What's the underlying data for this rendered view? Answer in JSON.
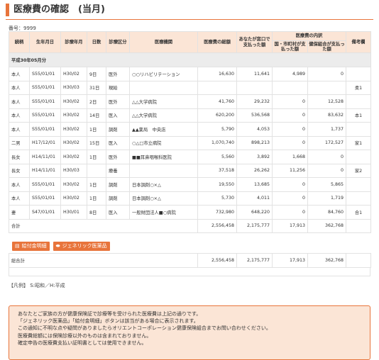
{
  "title": "医療費の確認　(当月)",
  "number_line": "番号：9999",
  "columns": {
    "name": "続柄",
    "birth": "生年月日",
    "service_month": "診療年月",
    "days": "日数",
    "category": "診療区分",
    "institution": "医療機関",
    "total": "医療費の総額",
    "patient_paid": "あなたが窓口で支払った額",
    "breakdown": "医療費の内訳",
    "public_paid": "国・市町村が支払った額",
    "insurer_paid": "健保組合が支払った額",
    "notes": "備考欄"
  },
  "group_label": "平成30年05月分",
  "rows": [
    {
      "rel": "本人",
      "birth": "S55/01/01",
      "month": "H30/02",
      "days": "9日",
      "cat": "医外",
      "inst": "○○リハビリテーション",
      "total": "16,630",
      "paid": "11,641",
      "public": "4,989",
      "insurer": "0",
      "note": ""
    },
    {
      "rel": "本人",
      "birth": "S55/01/01",
      "month": "H30/03",
      "days": "31日",
      "cat": "現給",
      "inst": "",
      "total": "",
      "paid": "",
      "public": "",
      "insurer": "",
      "note": "柔1"
    },
    {
      "rel": "本人",
      "birth": "S55/01/01",
      "month": "H30/02",
      "days": "2日",
      "cat": "医外",
      "inst": "△△大学病院",
      "total": "41,760",
      "paid": "29,232",
      "public": "0",
      "insurer": "12,528",
      "note": ""
    },
    {
      "rel": "本人",
      "birth": "S55/01/01",
      "month": "H30/02",
      "days": "14日",
      "cat": "医入",
      "inst": "△△大学病院",
      "total": "620,200",
      "paid": "536,568",
      "public": "0",
      "insurer": "83,632",
      "note": "本1"
    },
    {
      "rel": "本人",
      "birth": "S55/01/01",
      "month": "H30/02",
      "days": "1日",
      "cat": "調剤",
      "inst": "▲▲薬局　中央店",
      "total": "5,790",
      "paid": "4,053",
      "public": "0",
      "insurer": "1,737",
      "note": ""
    },
    {
      "rel": "二男",
      "birth": "H17/12/01",
      "month": "H30/02",
      "days": "15日",
      "cat": "医入",
      "inst": "○△□市立病院",
      "total": "1,070,740",
      "paid": "898,213",
      "public": "0",
      "insurer": "172,527",
      "note": "家1"
    },
    {
      "rel": "長女",
      "birth": "H14/11/01",
      "month": "H30/02",
      "days": "1日",
      "cat": "医外",
      "inst": "■■耳鼻咽喉科医院",
      "total": "5,560",
      "paid": "3,892",
      "public": "1,668",
      "insurer": "0",
      "note": ""
    },
    {
      "rel": "長女",
      "birth": "H14/11/01",
      "month": "H30/03",
      "days": "",
      "cat": "療養",
      "inst": "",
      "total": "37,518",
      "paid": "26,262",
      "public": "11,256",
      "insurer": "0",
      "note": "家2"
    },
    {
      "rel": "本人",
      "birth": "S55/01/01",
      "month": "H30/02",
      "days": "1日",
      "cat": "調剤",
      "inst": "日本調剤○×△",
      "total": "19,550",
      "paid": "13,685",
      "public": "0",
      "insurer": "5,865",
      "note": ""
    },
    {
      "rel": "本人",
      "birth": "S55/01/01",
      "month": "H30/02",
      "days": "1日",
      "cat": "調剤",
      "inst": "日本調剤○×△",
      "total": "5,730",
      "paid": "4,011",
      "public": "0",
      "insurer": "1,719",
      "note": ""
    },
    {
      "rel": "妻",
      "birth": "S47/01/01",
      "month": "H30/01",
      "days": "8日",
      "cat": "医入",
      "inst": "一般財団法人■○病院",
      "total": "732,980",
      "paid": "648,220",
      "public": "0",
      "insurer": "84,760",
      "note": "合1"
    }
  ],
  "subtotal": {
    "label": "合計",
    "total": "2,556,458",
    "paid": "2,175,777",
    "public": "17,913",
    "insurer": "362,768"
  },
  "buttons": {
    "pay_detail": "給付金明細",
    "generic": "ジェネリック医薬品"
  },
  "grand_total": {
    "label": "総合計",
    "total": "2,556,458",
    "paid": "2,175,777",
    "public": "17,913",
    "insurer": "362,768"
  },
  "legend": "【凡例】 S:昭和／H:平成",
  "notice_lines": [
    "あなたとご家族の方が健康保険証で診療等を受けられた医療費は上記の通りです。",
    "「ジェネリック医薬品」「給付金明細」ボタンは該当がある場合に表示されます。",
    "この通知に不明な点や疑問がありましたらオリエントコーポレーション健康保険組合までお問い合わせください。",
    "医療費総額には保険診療以外のものは含まれておりません。",
    "確定申告の医療費支払い証明書としては使用できません。"
  ],
  "colors": {
    "accent": "#e8743b",
    "header_bg": "#fbe5d6",
    "group_bg": "#ececec"
  },
  "icons": {
    "pay_detail": "document-icon",
    "generic": "pill-icon"
  }
}
